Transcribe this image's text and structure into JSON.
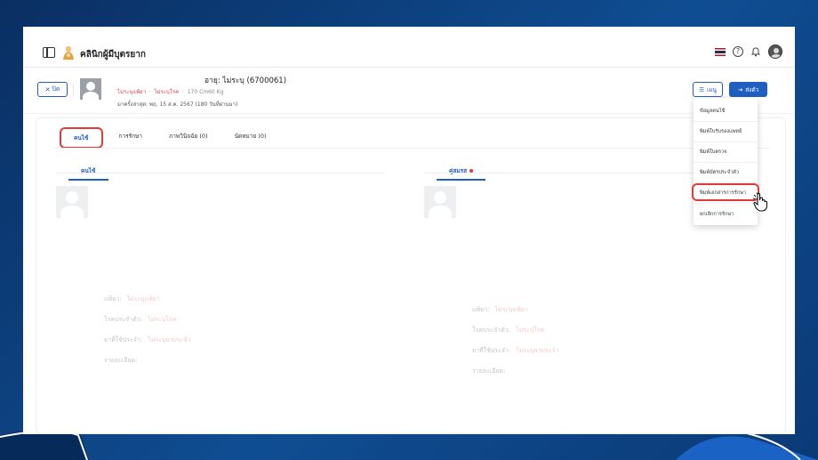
{
  "header": {
    "clinic_name": "คลินิกผู้มีบุตรยาก",
    "help_glyph": "?"
  },
  "patient": {
    "close_label": "ปิด",
    "age_line": "อายุ: ไม่ระบุ (6700061)",
    "info_red_1": "ไม่ระบุแพ้ยา",
    "info_red_2": "ไม่ระบุโรค",
    "info_vitals": "170 Cm60 Kg",
    "last_visit": "มาครั้งล่าสุด: พฤ. 15 ส.ค. 2567 (180 วันที่ผ่านมา)",
    "menu_label": "เมนู",
    "send_label": "ส่งตัว"
  },
  "tabs": [
    {
      "label": "คนไข้"
    },
    {
      "label": "การรักษา"
    },
    {
      "label": "ภาพวินิจฉัย (0)"
    },
    {
      "label": "นัดหมาย (0)"
    }
  ],
  "left_col": {
    "heading": "คนไข้",
    "fields": [
      {
        "label": "แพ้ยา:",
        "value": "ไม่ระบุแพ้ยา"
      },
      {
        "label": "โรคประจำตัว:",
        "value": "ไม่ระบุโรค"
      },
      {
        "label": "ยาที่ใช้ประจำ:",
        "value": "ไม่ระบุยาประจำ"
      },
      {
        "label": "รายละเอียด:",
        "value": ""
      }
    ]
  },
  "right_col": {
    "heading": "คู่สมรส",
    "fields": [
      {
        "label": "แพ้ยา:",
        "value": "ไม่ระบุแพ้ยา"
      },
      {
        "label": "โรคประจำตัว:",
        "value": "ไม่ระบุโรค"
      },
      {
        "label": "ยาที่ใช้ประจำ:",
        "value": "ไม่ระบุยาประจำ"
      },
      {
        "label": "รายละเอียด:",
        "value": ""
      }
    ]
  },
  "dropdown": {
    "items": [
      {
        "label": "ข้อมูลคนไข้"
      },
      {
        "label": "พิมพ์ใบรับรองแพทย์"
      },
      {
        "label": "พิมพ์ใบตรวจ"
      },
      {
        "label": "พิมพ์บัตรประจำตัว"
      },
      {
        "label": "พิมพ์เอกสารการรักษา"
      },
      {
        "label": "ยกเลิกการรักษา"
      }
    ]
  },
  "colors": {
    "accent": "#1f5fbf",
    "highlight": "#e53935",
    "background": "#0d3a73"
  }
}
